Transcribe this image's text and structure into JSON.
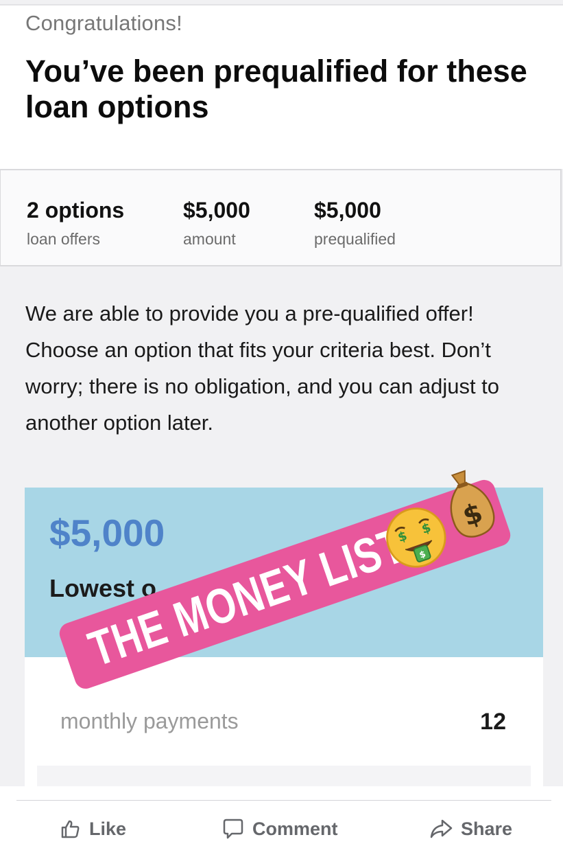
{
  "header": {
    "congrats": "Congratulations!",
    "headline": "You’ve been prequalified for these loan options"
  },
  "summary": {
    "stats": [
      {
        "value": "2 options",
        "label": "loan offers"
      },
      {
        "value": "$5,000",
        "label": "amount"
      },
      {
        "value": "$5,000",
        "label": "prequalified"
      }
    ]
  },
  "intro": "We are able to provide you a pre-qualified offer! Choose an option that fits your criteria best. Don’t worry; there is no obligation, and you can adjust to another option later.",
  "offer": {
    "amount": "$5,000",
    "subtitle": "Lowest o",
    "term_label": "monthly payments",
    "term_value": "12"
  },
  "sticker": {
    "text": "THE MONEY LIST",
    "emojis": [
      "money-mouth-face-icon",
      "money-bag-icon"
    ]
  },
  "actions": {
    "like": "Like",
    "comment": "Comment",
    "share": "Share"
  },
  "colors": {
    "offer_header_bg": "#a8d6e6",
    "offer_amount": "#4f83c9",
    "sticker_pink": "#e8579c",
    "fb_gray": "#65676b"
  }
}
